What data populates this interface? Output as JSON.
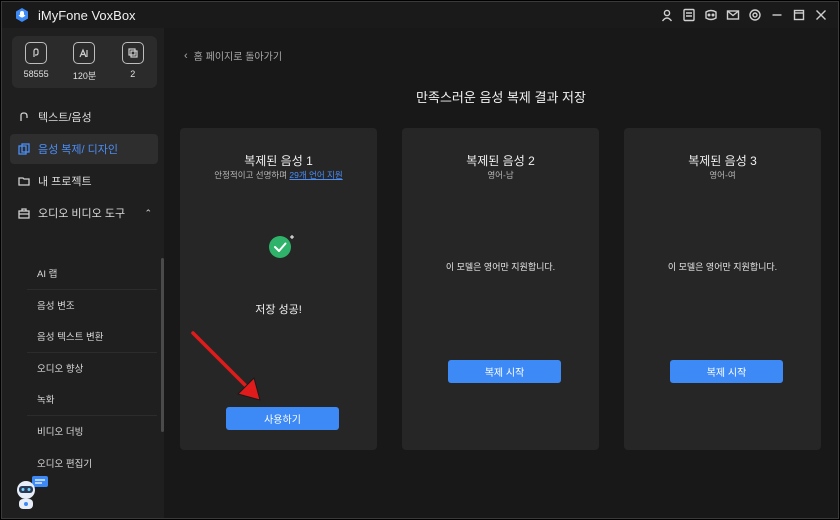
{
  "app": {
    "title": "iMyFone VoxBox"
  },
  "stats": [
    {
      "icon": "voice-char-icon",
      "value": "58555"
    },
    {
      "icon": "text-char-icon",
      "value": "120분"
    },
    {
      "icon": "copy-count-icon",
      "value": "2"
    }
  ],
  "nav": [
    {
      "label": "텍스트/음성",
      "icon": "text-to-speech-icon",
      "active": false
    },
    {
      "label": "음성 복제/ 디자인",
      "icon": "voice-clone-icon",
      "active": true
    },
    {
      "label": "내 프로젝트",
      "icon": "folder-icon",
      "active": false
    },
    {
      "label": "오디오 비디오 도구",
      "icon": "toolbox-icon",
      "active": false
    }
  ],
  "subnav": [
    "AI 랩",
    "음성 변조",
    "음성 텍스트 변환",
    "오디오 향상",
    "녹화",
    "비디오 더빙",
    "오디오 편집기"
  ],
  "main": {
    "back_label": "홈 페이지로 돌아가기",
    "heading": "만족스러운 음성 복제 결과 저장",
    "cards": [
      {
        "title": "복제된 음성 1",
        "sub_prefix": "안정적이고 선명하며 ",
        "sub_link": "29개 언어 지원",
        "success_text": "저장 성공!",
        "button": "사용하기"
      },
      {
        "title": "복제된 음성 2",
        "sub": "영어-남",
        "msg": "이 모델은 영어만 지원합니다.",
        "button": "복제 시작"
      },
      {
        "title": "복제된 음성 3",
        "sub": "영어-여",
        "msg": "이 모델은 영어만 지원합니다.",
        "button": "복제 시작"
      }
    ]
  },
  "colors": {
    "accent": "#3d8af7",
    "success": "#2fb36a",
    "annotation_arrow": "#e01b1b"
  }
}
